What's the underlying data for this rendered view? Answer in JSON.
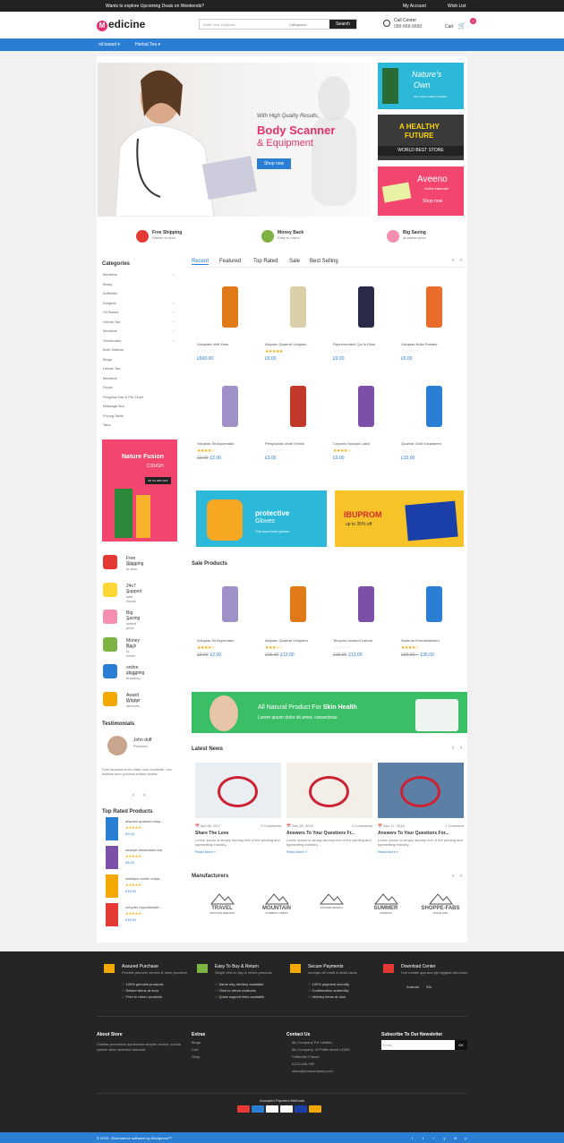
{
  "topbar": {
    "promo": "Wants to explore Upcoming Deals on Weekends?",
    "account": "My Account",
    "wishlist": "Wish List"
  },
  "header": {
    "logo": "edicine",
    "logo_letter": "M",
    "search_placeholder": "Enter Your Keyword...",
    "search_category": "Categories",
    "search_button": "Search",
    "call_title": "Call Center",
    "call_number": "088-888-8888",
    "cart_label": "Cart",
    "cart_count": "0"
  },
  "nav": {
    "items": [
      "oil based",
      "Herbal Tea"
    ]
  },
  "hero": {
    "tagline": "With High Quality Results_",
    "title1": "Body Scanner",
    "title2": "& Equipment",
    "button": "Shop now"
  },
  "side_banners": [
    {
      "title": "Nature's",
      "title2": "Own",
      "sub": "PUT YOUR HEALTH FIRST"
    },
    {
      "title": "A HEALTHY",
      "title2": "FUTURE",
      "sub": "WORLD BEST STORE"
    },
    {
      "title": "Aveeno",
      "sub": "Active Naturals",
      "button": "Shop now"
    }
  ],
  "features": [
    {
      "title": "Free Shipping",
      "sub": "Deliver to door"
    },
    {
      "title": "Money Back",
      "sub": "Easy to return"
    },
    {
      "title": "Big Saving",
      "sub": "at lowest price"
    }
  ],
  "categories": {
    "heading": "Categories",
    "items": [
      "Medicine",
      "Beaty",
      "Antibiotic",
      "Surgical",
      "Oil Based",
      "Herbal Tea",
      "Medicine",
      "Shortcodes",
      "Both Sidebar",
      "Blogs",
      "Herbal Tea",
      "Medicine",
      "Drops",
      "Progress Bar & Pie Chart",
      "Massage Box",
      "Pricing Table",
      "Tabs"
    ]
  },
  "promo_left": {
    "title": "Nature Fusion",
    "sub": "COUGH",
    "badge": "UP TO 20% OFF"
  },
  "tabs": [
    "Recent",
    "Featured",
    "Top Rated",
    "Sale",
    "Best Selling"
  ],
  "products": [
    {
      "name": "Voluptate Velit Esse",
      "rating": 0,
      "price": "£500.00",
      "old": ""
    },
    {
      "name": "Aliquam Quaerat Voluptat...",
      "rating": 5,
      "price": "£9.00",
      "old": ""
    },
    {
      "name": "Reprehenderit Qui In Esse",
      "rating": 0,
      "price": "£9.00",
      "old": ""
    },
    {
      "name": "Voluptas Nulla Pariatur",
      "rating": 0,
      "price": "£9.00",
      "old": ""
    },
    {
      "name": "Voluptas Sit Aspernatur",
      "rating": 4,
      "price": "£2.00",
      "old": "£3.00"
    },
    {
      "name": "Perspiciatis Unde Omnis",
      "rating": 0,
      "price": "£3.00",
      "old": ""
    },
    {
      "name": "Corporis Suscipit Labor",
      "rating": 4,
      "price": "£9.00",
      "old": ""
    },
    {
      "name": "Quaerat Gulit Voluptatem",
      "rating": 0,
      "price": "£15.00",
      "old": ""
    }
  ],
  "mid_banners": [
    {
      "title": "protective",
      "title2": "Gloves",
      "sub": "The word best gloves"
    },
    {
      "title": "IBUPROM",
      "sub": "up to 35% off"
    }
  ],
  "sale": {
    "heading": "Sale Products",
    "items": [
      {
        "name": "Voluptas Sit Aspernatur",
        "rating": 4,
        "price": "£2.00",
        "old": "£3.00"
      },
      {
        "name": "Aliquam Quaerat Voluptem",
        "rating": 3,
        "price": "£12.00",
        "old": "£15.00"
      },
      {
        "name": "Tempora Incidunt Labore",
        "rating": 0,
        "price": "£12.00",
        "old": "£15.00"
      },
      {
        "name": "Nostrum Exercitationem",
        "rating": 4,
        "price": "£35.00",
        "old": "£30.00 –"
      }
    ]
  },
  "side_features": [
    {
      "title": "Free Shipping",
      "sub": "Deliver to door"
    },
    {
      "title": "24x7 Support",
      "sub": "in safe hands"
    },
    {
      "title": "Big Saving",
      "sub": "at lowest price"
    },
    {
      "title": "Money Back",
      "sub": "Easy to return"
    },
    {
      "title": "online shopping",
      "sub": "a huge branding"
    },
    {
      "title": "Award Winner",
      "sub": "for best services"
    }
  ],
  "skin_banner": {
    "title": "All Natural Product For",
    "title_em": "Skin Health",
    "sub": "Lorem ipsum dolor sit amet, consectetur"
  },
  "testimonials": {
    "heading": "Testimonials",
    "name": "John duff",
    "role": "Producer",
    "text": "Duis faucibus enim vitae nunc molestie, nec facilisis arcu pulvinar nullam mattis."
  },
  "top_rated": {
    "heading": "Top Rated Products",
    "items": [
      {
        "name": "aliquam quaerat volup...",
        "price": "£9.00"
      },
      {
        "name": "suscipit laboriosam nisi",
        "price": "£8.00"
      },
      {
        "name": "similique suntin culpa...",
        "price": "£15.00"
      },
      {
        "name": "volupter repudiandae...",
        "price": "£15.00"
      }
    ]
  },
  "news": {
    "heading": "Latest News",
    "items": [
      {
        "date": "Apr 08, 2017",
        "comments": "0 Comments",
        "title": "Share The Love",
        "desc": "Lorem Ipsum is simply dummy text of the printing and typesetting industry....",
        "more": "Read More »"
      },
      {
        "date": "Dec 28, 2015",
        "comments": "0 Comments",
        "title": "Answers To Your Questions Fr...",
        "desc": "Lorem Ipsum is simply dummy text of the printing and typesetting industry....",
        "more": "Read More »"
      },
      {
        "date": "Nov 17, 2015",
        "comments": "1 Comment",
        "title": "Answers To Your Questions For...",
        "desc": "Lorem Ipsum is simply dummy text of the printing and typesetting industry....",
        "more": "Read More »"
      }
    ]
  },
  "manufacturers": {
    "heading": "Manufacturers",
    "items": [
      {
        "name": "TRAVEL",
        "sub": "WALKING DREAMS"
      },
      {
        "name": "MOUNTAIN",
        "sub": "CLIMBING CREST"
      },
      {
        "name": "",
        "sub": "VINTAGE DESIGN"
      },
      {
        "name": "SUMMER",
        "sub": "CAMPING"
      },
      {
        "name": "SHOPPE-FABS",
        "sub": "SINCE 1997"
      }
    ]
  },
  "footer_features": [
    {
      "title": "Assured Purchase",
      "sub": "Provide genuine service & store products",
      "lines": [
        "100% genuine products",
        "Deliver items at door",
        "Free to return products"
      ]
    },
    {
      "title": "Easy To Buy & Return",
      "sub": "Single click to buy & return products",
      "lines": [
        "Same day devilery available",
        "Click to return products",
        "Quick support links available"
      ]
    },
    {
      "title": "Secure Payments",
      "sub": "Accepts all credit & debit cards",
      "lines": [
        "100% payment security",
        "Confirmation authentity",
        "delivery items at door"
      ]
    },
    {
      "title": "Download Center",
      "sub": "Use mobile app and get biggest discounts",
      "lines": [
        "Android",
        "iOs"
      ]
    }
  ],
  "footer": {
    "about_title": "About Store",
    "about_text": "Claritas processus dynamicus sequitu consut, consut ryethm sitter smireted oeuresti.",
    "extras_title": "Extras",
    "extras": [
      "Blogs",
      "Cart",
      "Shop"
    ],
    "contact_title": "Contact Us",
    "contact": [
      "My Company Pvt Limited,",
      "My Company, 42 Puffin street 12345",
      "Puffinville France",
      "0123-456-789",
      "sales@yourcompany.com"
    ],
    "newsletter_title": "Subscribe To Our Newsletter",
    "newsletter_placeholder": "Email",
    "newsletter_button": "OK",
    "payment_title": "Accepted Payment Methods",
    "copyright": "© 2018 - Ecommerce software by Wordpress™"
  },
  "colors": {
    "brand_blue": "#2a7fd4",
    "brand_pink": "#e5306b",
    "dark": "#252525"
  }
}
